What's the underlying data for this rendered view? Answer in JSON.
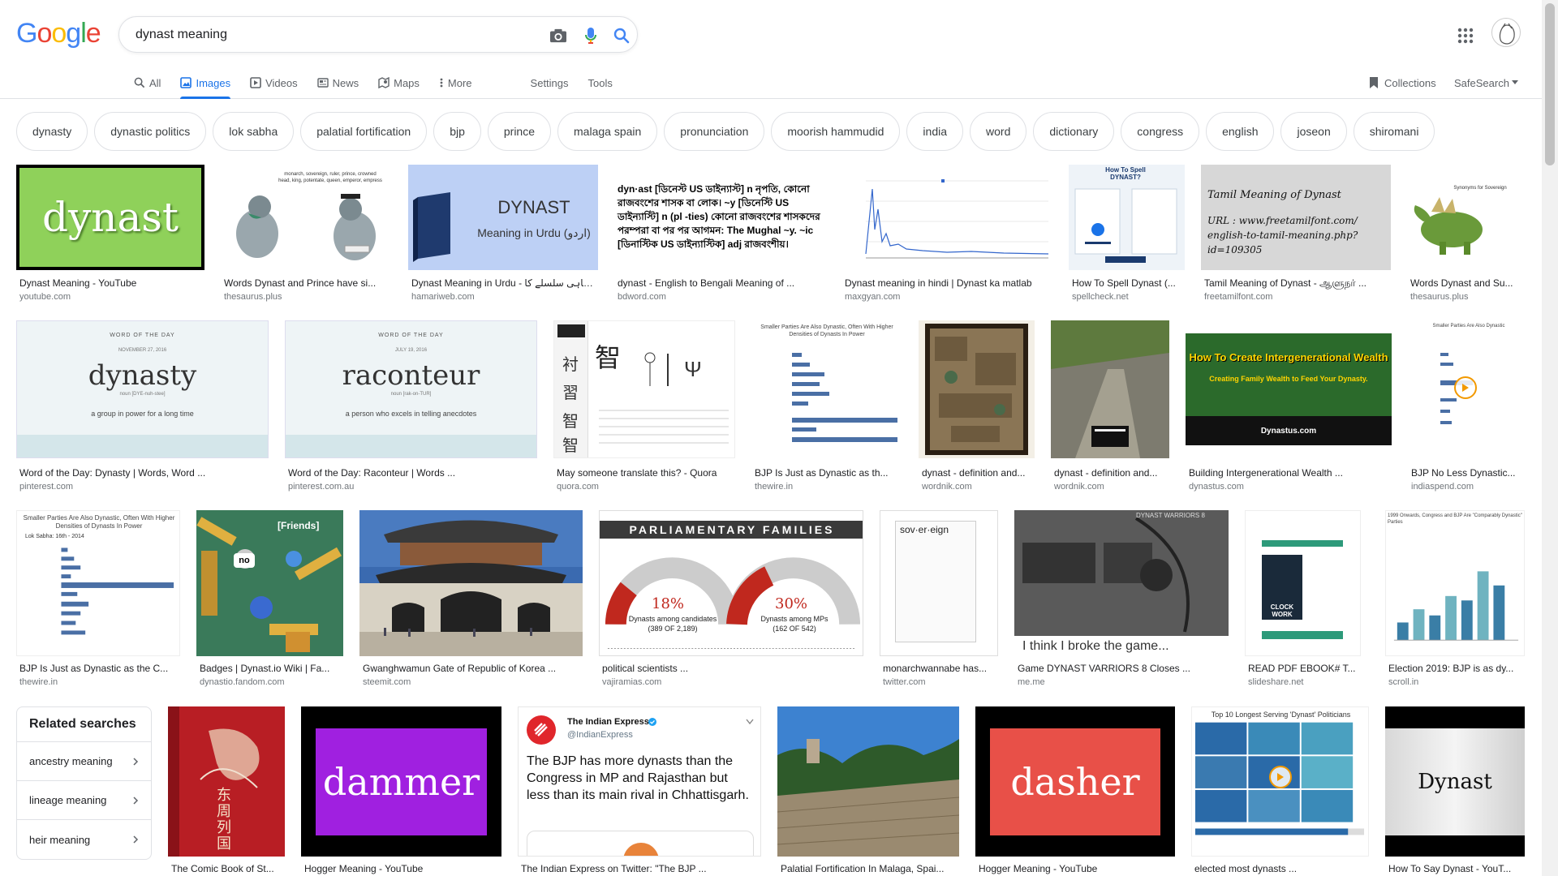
{
  "logo": [
    "G",
    "o",
    "o",
    "g",
    "l",
    "e"
  ],
  "logo_colors": [
    "#4285f4",
    "#ea4335",
    "#fbbc05",
    "#4285f4",
    "#34a853",
    "#ea4335"
  ],
  "search": {
    "query": "dynast meaning"
  },
  "tabs": {
    "all": "All",
    "images": "Images",
    "videos": "Videos",
    "news": "News",
    "maps": "Maps",
    "more": "More",
    "settings": "Settings",
    "tools": "Tools"
  },
  "right_tools": {
    "collections": "Collections",
    "safesearch": "SafeSearch"
  },
  "chips": [
    "dynasty",
    "dynastic politics",
    "lok sabha",
    "palatial fortification",
    "bjp",
    "prince",
    "malaga spain",
    "pronunciation",
    "moorish hammudid",
    "india",
    "word",
    "dictionary",
    "congress",
    "english",
    "joseon",
    "shiromani"
  ],
  "related": {
    "heading": "Related searches",
    "items": [
      "ancestry meaning",
      "lineage meaning",
      "heir meaning"
    ]
  },
  "results": {
    "r1": [
      {
        "title": "Dynast Meaning - YouTube",
        "source": "youtube.com",
        "text": "dynast"
      },
      {
        "title": "Words Dynast and Prince have si...",
        "source": "thesaurus.plus",
        "text": "monarch, sovereign, ruler, prince, crowned head, king, potentate, queen, emperor, empress"
      },
      {
        "title": "Dynast Meaning in Urdu - شاہی سلسلے کا ...",
        "source": "hamariweb.com",
        "text": "DYNAST",
        "text2": "Meaning in Urdu (اردو)"
      },
      {
        "title": "dynast - English to Bengali Meaning of ...",
        "source": "bdword.com",
        "text": "dyn·ast [ডিনেস্ট US ডাইন্যাস্ট] n নৃপতি, কোনো রাজবংশের শাসক বা লোক। ~y [ডিনেস্টি US ডাইন্যাস্টি] n (pl -ties) কোনো রাজবংশের শাসকদের পরম্পরা বা পর পর আগমন: The Mughal ~y. ~ic [ডিনাস্টিক US ডাইন্যাস্টিক] adj রাজবংশীয়।"
      },
      {
        "title": "Dynast meaning in hindi | Dynast ka matlab",
        "source": "maxgyan.com"
      },
      {
        "title": "How To Spell Dynast (...",
        "source": "spellcheck.net",
        "text": "How To Spell DYNAST?"
      },
      {
        "title": "Tamil Meaning of Dynast - ஆளுநர் ...",
        "source": "freetamilfont.com",
        "text": "Tamil Meaning of Dynast",
        "text2": "URL : www.freetamilfont.com/ english-to-tamil-meaning.php?id=109305"
      },
      {
        "title": "Words Dynast and Su...",
        "source": "thesaurus.plus",
        "text": "Synonyms for Sovereign"
      }
    ],
    "r2": [
      {
        "title": "Word of the Day: Dynasty | Words, Word ...",
        "source": "pinterest.com",
        "kicker": "WORD OF THE DAY",
        "date": "NOVEMBER 27, 2016",
        "word": "dynasty",
        "pron": "noun [DYE-nuh-stee]",
        "def": "a group in power for a long time"
      },
      {
        "title": "Word of the Day: Raconteur | Words ...",
        "source": "pinterest.com.au",
        "kicker": "WORD OF THE DAY",
        "date": "JULY 19, 2016",
        "word": "raconteur",
        "pron": "noun [rak-on-TUR]",
        "def": "a person who excels in telling anecdotes"
      },
      {
        "title": "May someone translate this? - Quora",
        "source": "quora.com",
        "text": "智"
      },
      {
        "title": "BJP Is Just as Dynastic as th...",
        "source": "thewire.in",
        "text": "Smaller Parties Are Also Dynastic, Often With Higher Densities of Dynasts In Power"
      },
      {
        "title": "dynast - definition and...",
        "source": "wordnik.com"
      },
      {
        "title": "dynast - definition and...",
        "source": "wordnik.com"
      },
      {
        "title": "Building Intergenerational Wealth ...",
        "source": "dynastus.com",
        "text": "How To Create Intergenerational Wealth",
        "text2": "Creating Family Wealth to Feed Your Dynasty.",
        "text3": "Dynastus.com"
      },
      {
        "title": "BJP No Less Dynastic...",
        "source": "indiaspend.com",
        "text": "Smaller Parties Are Also Dynastic"
      }
    ],
    "r3": [
      {
        "title": "BJP Is Just as Dynastic as the C...",
        "source": "thewire.in",
        "text": "Smaller Parties Are Also Dynastic, Often With Higher Densities of Dynasts In Power",
        "text2": "Lok Sabha: 16th - 2014"
      },
      {
        "title": "Badges | Dynast.io Wiki | Fa...",
        "source": "dynastio.fandom.com",
        "text": "[Friends]",
        "text2": "no"
      },
      {
        "title": "Gwanghwamun Gate of Republic of Korea ...",
        "source": "steemit.com"
      },
      {
        "title": "political scientists ...",
        "source": "vajiramias.com",
        "text": "PARLIAMENTARY FAMILIES",
        "p1": "18%",
        "l1": "Dynasts among candidates",
        "s1": "(389 OF 2,189)",
        "p2": "30%",
        "l2": "Dynasts among MPs",
        "s2": "(162 OF 542)"
      },
      {
        "title": "monarchwannabe has...",
        "source": "twitter.com",
        "text": "sov·er·eign"
      },
      {
        "title": "Game DYNAST VARRIORS 8 Closes ...",
        "source": "me.me",
        "text": "I think I broke the game...",
        "text2": "DYNAST WARRIORS 8"
      },
      {
        "title": "READ PDF EBOOK# T...",
        "source": "slideshare.net",
        "text": "CLOCK WORK"
      },
      {
        "title": "Election 2019: BJP is as dy...",
        "source": "scroll.in",
        "text": "1999 Onwards, Congress and BJP Are \"Comparably Dynastic\" Parties",
        "bars": [
          20,
          35,
          28,
          50,
          45,
          78,
          62
        ]
      }
    ],
    "r4": [
      {
        "title": "The Comic Book of St...",
        "source": "",
        "text": "东周列国"
      },
      {
        "title": "Hogger Meaning - YouTube",
        "source": "",
        "text": "dammer"
      },
      {
        "title": "The Indian Express on Twitter: \"The BJP ...",
        "source": "",
        "name": "The Indian Express",
        "handle": "@IndianExpress",
        "tweet": "The BJP has more dynasts than the Congress in MP and Rajasthan but less than its main rival in Chhattisgarh."
      },
      {
        "title": "Palatial Fortification In Malaga, Spai...",
        "source": ""
      },
      {
        "title": "Hogger Meaning - YouTube",
        "source": "",
        "text": "dasher"
      },
      {
        "title": "elected most dynasts ...",
        "source": "",
        "text": "Top 10 Longest Serving 'Dynast' Politicians"
      },
      {
        "title": "How To Say Dynast - YouT...",
        "source": "",
        "text": "Dynast"
      }
    ]
  },
  "colors": {
    "accent": "#1a73e8",
    "border": "#dfe1e5",
    "muted": "#70757a"
  }
}
